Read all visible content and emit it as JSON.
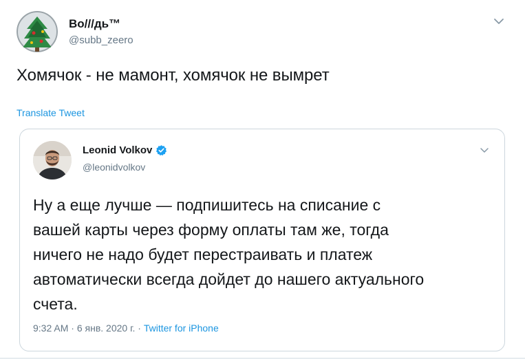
{
  "tweet": {
    "display_name": "Bo///дь™",
    "handle": "@subb_zeero",
    "text": "Хомячок - не мамонт, хомячок не вымрет",
    "translate_label": "Translate Tweet"
  },
  "quoted": {
    "display_name": "Leonid Volkov",
    "handle": "@leonidvolkov",
    "verified": true,
    "lines": [
      "Ну а еще лучше — подпишитесь на списание с",
      "вашей карты через форму оплаты там же, тогда",
      "ничего не надо будет перестраивать и платеж",
      "автоматически всегда дойдет до нашего актуального",
      "счета."
    ],
    "time": "9:32 AM",
    "date": "6 янв. 2020 г.",
    "separator": "·",
    "source": "Twitter for iPhone"
  },
  "colors": {
    "link": "#1b95e0",
    "verified": "#1da1f2",
    "secondary_text": "#657786",
    "border": "#ccd6dd"
  },
  "icons": {
    "menu": "chevron-down-icon",
    "verified": "verified-badge-icon"
  }
}
